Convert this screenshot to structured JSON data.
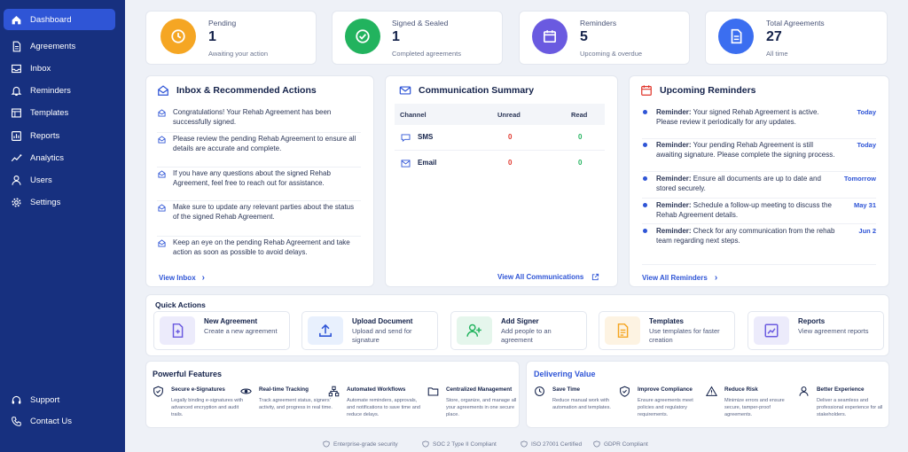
{
  "sidebar": {
    "items": [
      {
        "label": "Dashboard",
        "icon": "home-icon"
      },
      {
        "label": "Agreements",
        "icon": "document-icon"
      },
      {
        "label": "Inbox",
        "icon": "inbox-icon"
      },
      {
        "label": "Reminders",
        "icon": "bell-icon"
      },
      {
        "label": "Templates",
        "icon": "template-icon"
      },
      {
        "label": "Reports",
        "icon": "report-icon"
      },
      {
        "label": "Analytics",
        "icon": "chart-icon"
      },
      {
        "label": "Users",
        "icon": "users-icon"
      },
      {
        "label": "Settings",
        "icon": "gear-icon"
      }
    ],
    "bottom": [
      {
        "label": "Support",
        "icon": "headset-icon"
      },
      {
        "label": "Contact Us",
        "icon": "phone-icon"
      }
    ]
  },
  "stats": [
    {
      "title": "Pending",
      "value": "1",
      "sub": "Awaiting your action",
      "color": "#f5a623",
      "icon": "clock-icon"
    },
    {
      "title": "Signed & Sealed",
      "value": "1",
      "sub": "Completed agreements",
      "color": "#22b35e",
      "icon": "check-circle-icon"
    },
    {
      "title": "Reminders",
      "value": "5",
      "sub": "Upcoming & overdue",
      "color": "#6a5ae0",
      "icon": "calendar-icon"
    },
    {
      "title": "Total Agreements",
      "value": "27",
      "sub": "All time",
      "color": "#3b6ef0",
      "icon": "document-icon"
    }
  ],
  "inbox": {
    "title": "Inbox & Recommended Actions",
    "items": [
      "Congratulations! Your Rehab Agreement has been successfully signed.",
      "Please review the pending Rehab Agreement to ensure all details are accurate and complete.",
      "If you have any questions about the signed Rehab Agreement, feel free to reach out for assistance.",
      "Make sure to update any relevant parties about the status of the signed Rehab Agreement.",
      "Keep an eye on the pending Rehab Agreement and take action as soon as possible to avoid delays."
    ],
    "link": "View Inbox"
  },
  "communication": {
    "title": "Communication Summary",
    "headers": [
      "Channel",
      "Unread",
      "Read"
    ],
    "rows": [
      {
        "channel": "SMS",
        "unread": "0",
        "read": "0"
      },
      {
        "channel": "Email",
        "unread": "0",
        "read": "0"
      }
    ],
    "link": "View All Communications"
  },
  "reminders": {
    "title": "Upcoming Reminders",
    "prefix": "Reminder:",
    "items": [
      {
        "text": "Your signed Rehab Agreement is active. Please review it periodically for any updates.",
        "date": "Today"
      },
      {
        "text": "Your pending Rehab Agreement is still awaiting signature. Please complete the signing process.",
        "date": "Today"
      },
      {
        "text": "Ensure all documents are up to date and stored securely.",
        "date": "Tomorrow"
      },
      {
        "text": "Schedule a follow-up meeting to discuss the Rehab Agreement details.",
        "date": "May 31"
      },
      {
        "text": "Check for any communication from the rehab team regarding next steps.",
        "date": "Jun 2"
      }
    ],
    "link": "View All Reminders"
  },
  "quick_actions": {
    "title": "Quick Actions",
    "items": [
      {
        "name": "New Agreement",
        "desc": "Create a new agreement",
        "icon": "new-document-icon",
        "color": "#ecebfb"
      },
      {
        "name": "Upload Document",
        "desc": "Upload and send for signature",
        "icon": "upload-icon",
        "color": "#e8f0fd"
      },
      {
        "name": "Add Signer",
        "desc": "Add people to an agreement",
        "icon": "add-user-icon",
        "color": "#e5f6ec"
      },
      {
        "name": "Templates",
        "desc": "Use templates for faster creation",
        "icon": "template-icon",
        "color": "#fdf3e2"
      },
      {
        "name": "Reports",
        "desc": "View agreement reports",
        "icon": "report-icon",
        "color": "#ecebfb"
      }
    ]
  },
  "features": {
    "title": "Powerful Features",
    "items": [
      {
        "name": "Secure e-Signatures",
        "desc": "Legally binding e-signatures with advanced encryption and audit trails.",
        "icon": "shield-check-icon"
      },
      {
        "name": "Real-time Tracking",
        "desc": "Track agreement status, signers' activity, and progress in real time.",
        "icon": "eye-icon"
      },
      {
        "name": "Automated Workflows",
        "desc": "Automate reminders, approvals, and notifications to save time and reduce delays.",
        "icon": "workflow-icon"
      },
      {
        "name": "Centralized Management",
        "desc": "Store, organize, and manage all your agreements in one secure place.",
        "icon": "folder-icon"
      }
    ]
  },
  "value": {
    "title": "Delivering Value",
    "items": [
      {
        "name": "Save Time",
        "desc": "Reduce manual work with automation and templates.",
        "icon": "clock-icon"
      },
      {
        "name": "Improve Compliance",
        "desc": "Ensure agreements meet policies and regulatory requirements.",
        "icon": "shield-check-icon"
      },
      {
        "name": "Reduce Risk",
        "desc": "Minimize errors and ensure secure, tamper-proof agreements.",
        "icon": "warning-icon"
      },
      {
        "name": "Better Experience",
        "desc": "Deliver a seamless and professional experience for all stakeholders.",
        "icon": "user-icon"
      }
    ]
  },
  "footer": [
    "Enterprise-grade security",
    "SOC 2 Type II Compliant",
    "ISO 27001 Certified",
    "GDPR Compliant"
  ]
}
